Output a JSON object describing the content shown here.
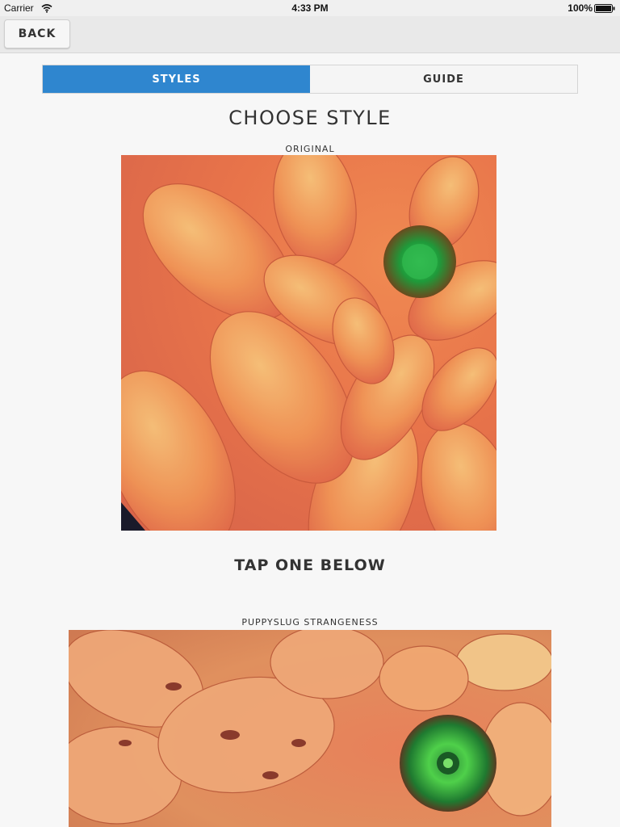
{
  "status_bar": {
    "carrier": "Carrier",
    "time": "4:33 PM",
    "battery": "100%"
  },
  "nav": {
    "back_label": "BACK"
  },
  "tabs": [
    {
      "label": "STYLES",
      "active": true
    },
    {
      "label": "GUIDE",
      "active": false
    }
  ],
  "main": {
    "title": "CHOOSE STYLE",
    "original_label": "ORIGINAL",
    "tap_instruction": "TAP ONE BELOW",
    "styles": [
      {
        "label": "PUPPYSLUG STRANGENESS"
      }
    ]
  },
  "colors": {
    "accent": "#2f86cf",
    "background": "#f7f7f7",
    "nav_background": "#e9e9e9"
  }
}
